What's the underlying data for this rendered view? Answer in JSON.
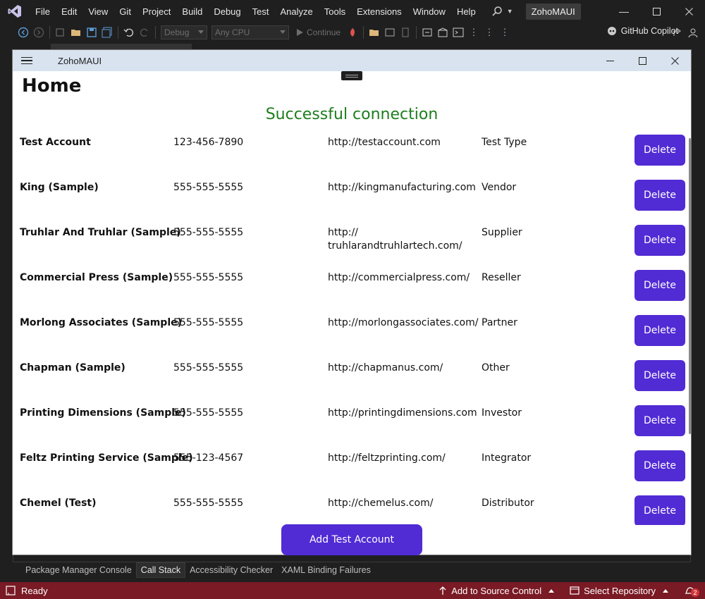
{
  "vs": {
    "menu": [
      "File",
      "Edit",
      "View",
      "Git",
      "Project",
      "Build",
      "Debug",
      "Test",
      "Analyze",
      "Tools",
      "Extensions",
      "Window",
      "Help"
    ],
    "solution_name": "ZohoMAUI",
    "toolbar": {
      "config": "Debug",
      "platform": "Any CPU",
      "continue_label": "Continue",
      "copilot_label": "GitHub Copilot"
    },
    "bottom_tabs": [
      "Package Manager Console",
      "Call Stack",
      "Accessibility Checker",
      "XAML Binding Failures"
    ],
    "active_bottom_tab": "Call Stack",
    "status": {
      "ready": "Ready",
      "source_control": "Add to Source Control",
      "repository": "Select Repository",
      "notifications": "2"
    },
    "accent": "#7a1a24"
  },
  "app": {
    "window_title": "ZohoMAUI",
    "page_title": "Home",
    "connection_status": "Successful connection",
    "status_color": "#1e7d1e",
    "button_color": "#512bd4",
    "delete_label": "Delete",
    "add_button_label": "Add Test Account",
    "accounts": [
      {
        "name": "Test Account",
        "phone": "123-456-7890",
        "url": "http://testaccount.com",
        "type": "Test Type"
      },
      {
        "name": "King (Sample)",
        "phone": "555-555-5555",
        "url": "http://kingmanufacturing.com",
        "type": "Vendor"
      },
      {
        "name": "Truhlar And Truhlar (Sample)",
        "phone": "555-555-5555",
        "url": "http://\ntruhlarandtruhlartech.com/",
        "type": "Supplier"
      },
      {
        "name": "Commercial Press (Sample)",
        "phone": "555-555-5555",
        "url": "http://commercialpress.com/",
        "type": "Reseller"
      },
      {
        "name": "Morlong Associates (Sample)",
        "phone": "555-555-5555",
        "url": "http://morlongassociates.com/",
        "type": "Partner"
      },
      {
        "name": "Chapman (Sample)",
        "phone": "555-555-5555",
        "url": "http://chapmanus.com/",
        "type": "Other"
      },
      {
        "name": "Printing Dimensions (Sample)",
        "phone": "555-555-5555",
        "url": "http://printingdimensions.com",
        "type": "Investor"
      },
      {
        "name": "Feltz Printing Service (Sample)",
        "phone": "555-123-4567",
        "url": "http://feltzprinting.com/",
        "type": "Integrator"
      },
      {
        "name": "Chemel (Test)",
        "phone": "555-555-5555",
        "url": "http://chemelus.com/",
        "type": "Distributor"
      }
    ]
  }
}
